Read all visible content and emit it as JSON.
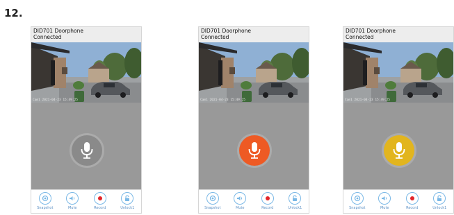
{
  "step_number": "12.",
  "phones": [
    {
      "device_name": "DID701 Doorphone",
      "status": "Connected",
      "timestamp": "Cam1  2021-04-23  15:49:25",
      "mic_color": "#8a8a8a",
      "mic_state": "idle"
    },
    {
      "device_name": "DID701 Doorphone",
      "status": "Connected",
      "timestamp": "Cam1  2021-04-23  15:49:25",
      "mic_color": "#ee5a24",
      "mic_state": "talking"
    },
    {
      "device_name": "DID701 Doorphone",
      "status": "Connected",
      "timestamp": "Cam1  2021-04-23  15:49:25",
      "mic_color": "#e2b51e",
      "mic_state": "listening"
    }
  ],
  "toolbar": {
    "snapshot_label": "Snapshot",
    "mute_label": "Mute",
    "record_label": "Record",
    "unlock_label": "Unlock1"
  },
  "icons": [
    "snapshot-icon",
    "speaker-icon",
    "record-icon",
    "unlock-icon",
    "microphone-icon"
  ],
  "colors": {
    "accent": "#7ab8e6",
    "record": "#e2262b",
    "label": "#5a8fc4"
  }
}
